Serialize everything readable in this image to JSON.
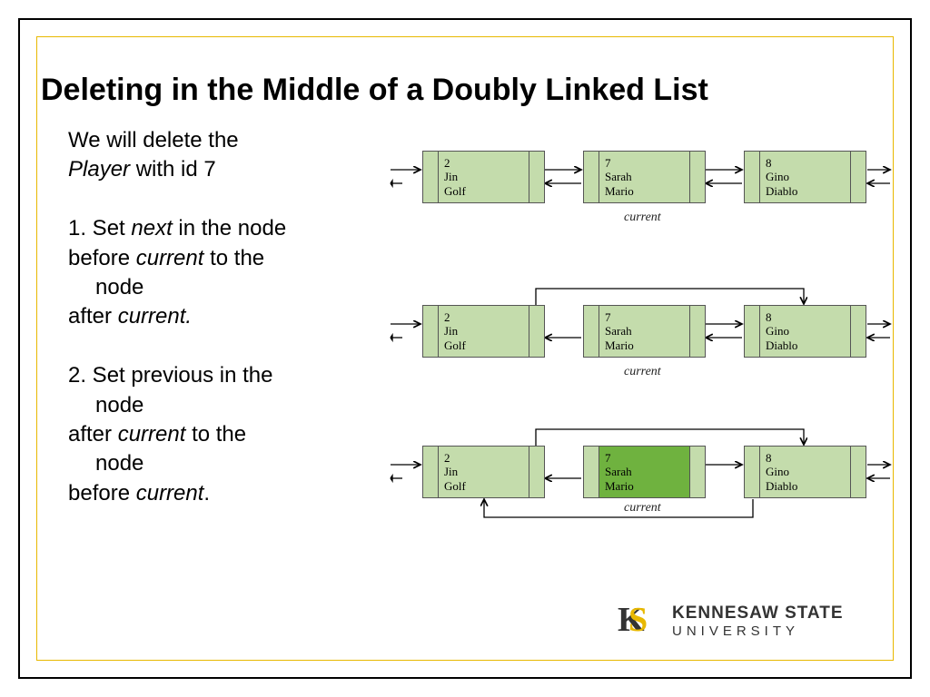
{
  "title": "Deleting in the Middle of a Doubly Linked List",
  "intro_line1": "We will delete the",
  "intro_line2_italic": "Player",
  "intro_line2_rest": " with id 7",
  "step1_a": "1.   Set ",
  "step1_next": "next",
  "step1_b": " in the node",
  "step1_c": "before ",
  "step1_current1": "current",
  "step1_d": " to the",
  "step1_e": "node",
  "step1_f": "after ",
  "step1_current2": "current.",
  "step2_a": "2. Set previous in the",
  "step2_b": "node",
  "step2_c": "after ",
  "step2_current1": "current",
  "step2_d": " to the",
  "step2_e": "node",
  "step2_f": "before ",
  "step2_current2": "current",
  "step2_g": ".",
  "nodes": {
    "n1": {
      "id": "2",
      "name": "Jin",
      "game": "Golf"
    },
    "n2": {
      "id": "7",
      "name": "Sarah",
      "game": "Mario"
    },
    "n3": {
      "id": "8",
      "name": "Gino",
      "game": "Diablo"
    }
  },
  "caption": "current",
  "logo": {
    "line1": "KENNESAW STATE",
    "line2": "UNIVERSITY"
  }
}
